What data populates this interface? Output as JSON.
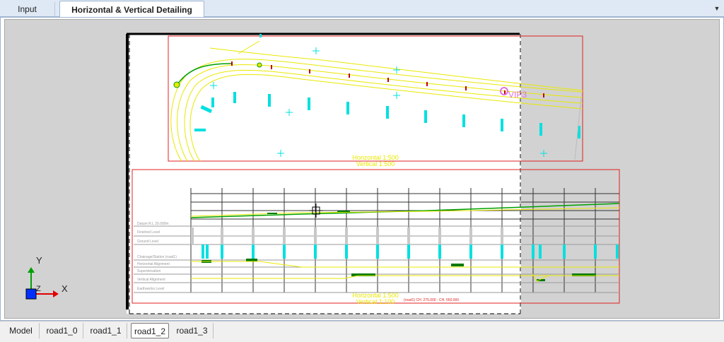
{
  "top_tabs": [
    {
      "label": "Input",
      "active": false
    },
    {
      "label": "Horizontal & Vertical Detailing",
      "active": true
    }
  ],
  "dropdown_icon": "chevron-down-icon",
  "plan": {
    "scale_horizontal": "Horizontal  1:500",
    "scale_vertical": "Vertical  1:500",
    "label_vip": "VIP3"
  },
  "profile": {
    "row_labels": [
      "Datum R.L 20.000m",
      "Finished Level",
      "Ground Level",
      "Chainage/Station  (road1)",
      "Horizontal  Alignment",
      "Superelevation",
      "Vertical  Alignment",
      "Earthworks Level"
    ],
    "scale_horizontal": "Horizontal  1:500",
    "scale_vertical": "Vertical  1:100",
    "chainage_note": "(road1) CH. 275.000 - CH. 550.000"
  },
  "axes": {
    "y_label": "Y",
    "x_label": "X",
    "z_label": "Z"
  },
  "layout_tabs": [
    {
      "label": "Model",
      "active": false
    },
    {
      "label": "road1_0",
      "active": false
    },
    {
      "label": "road1_1",
      "active": false
    },
    {
      "label": "road1_2",
      "active": true
    },
    {
      "label": "road1_3",
      "active": false
    }
  ]
}
